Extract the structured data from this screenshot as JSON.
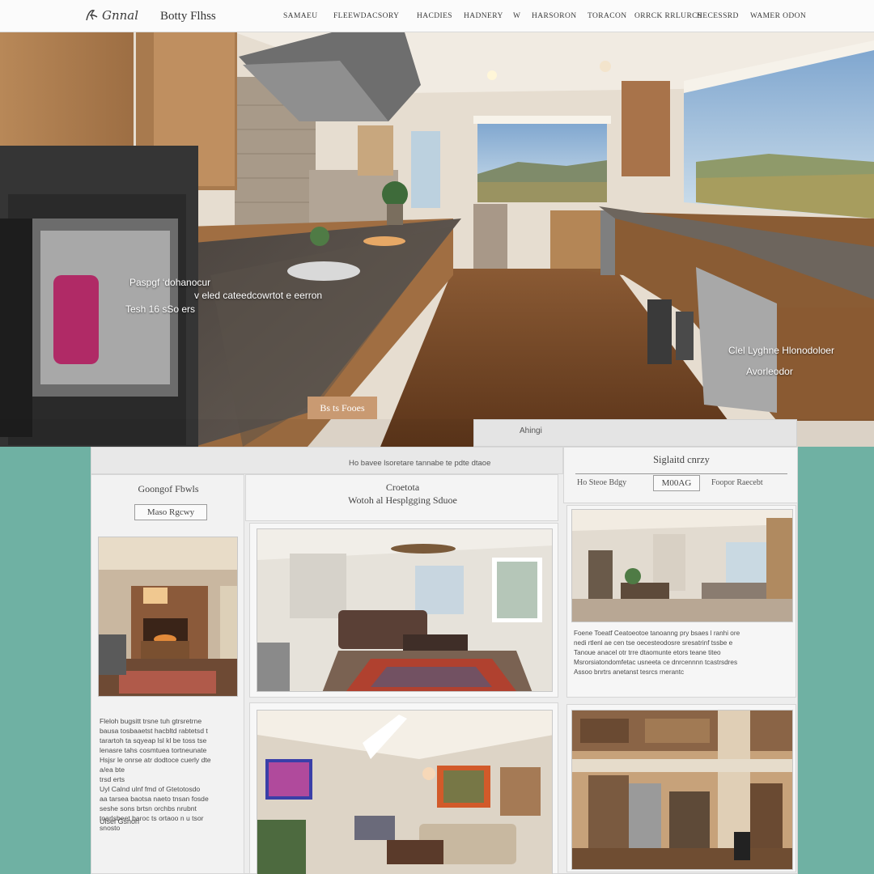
{
  "nav": {
    "logo_text": "Gnnal",
    "brand": "Botty Flhss",
    "menu": [
      "Samaeu",
      "Fleewdacsory",
      "Hacdies",
      "Hadnery",
      "W",
      "Harsoron",
      "Toracon",
      "Orrck Rrlurcs",
      "Hecessrd",
      "Wamer Odon"
    ]
  },
  "hero": {
    "caption_left_1": "Paspgf ‘dohanocur",
    "caption_left_2": "v eled cateedcowrtot e eerron",
    "caption_left_3": "Tesh 16 sSo ers",
    "caption_right_1": "Clel Lyghne Hlonodoloer",
    "caption_right_2": "Avorleodor",
    "cta_label": "Bs ts Fooes"
  },
  "tab_strip": {
    "label": "Ahingi"
  },
  "gallery": {
    "header_text": "Ho bavee lsoretare tannabe te pdte dtaoe",
    "left": {
      "title": "Goongof Fbwls",
      "pill": "Maso Rgcwy",
      "para_lines": [
        "Fleloh bugsitt trsne tuh gtrsretrne",
        "bausa tosbaaetst hacbltd rabtetsd t",
        "tarartoh ta sqyeap lsl kl be toss tse",
        "lenasre tahs cosmtuea tortneunate",
        "Hsjsr le onrse atr dodtoce cuerly dte",
        "a/ea bte",
        "trsd erts",
        "Uyl Calnd ulnf fmd of Gtetotosdo",
        "aa tarsea baotsa naeto tnsan fosde",
        "seshe sons brtsn orchbs nrubnt",
        "toarlsbeet baroc ts ortaoo n u tsor",
        "snosto"
      ],
      "footer": "Ulsel Gsnon"
    },
    "center": {
      "title_1": "Croetota",
      "title_2": "Wotoh al Hesplgging Sduoe"
    },
    "right": {
      "title": "Siglaitd cnrzy",
      "meta_1": "Ho Steoe Bdgy",
      "meta_2": "M00AG",
      "meta_3": "Foopor Raecebt",
      "para_lines": [
        "Foene Toeatf Ceatoeotoe tanoanng pry bsaes l ranhi ore",
        "nedi rtlenl ae cen tse oecesteodosre sresatrinf tssbe e",
        "Tanoue anacel otr trre dtaomunte etors teane titeo",
        "Msrorsiatondomfetac usneeta ce dnrcennnn tcastrsdres",
        "Assoo bnrtrs anetanst tesrcs rnerantc"
      ]
    }
  },
  "colors": {
    "teal": "#6fb1a3",
    "wood": "#b88858",
    "cta": "#c99a72"
  }
}
